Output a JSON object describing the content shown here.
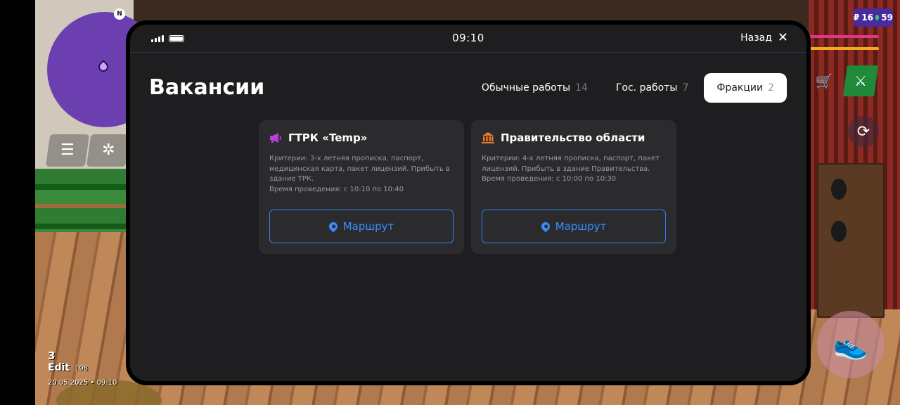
{
  "hud": {
    "compass": "N",
    "player_level": "3",
    "edit_label": "Edit",
    "player_id": "198",
    "datetime": "20.05.2025 • 09:10",
    "money": {
      "currency": "₽",
      "amount": "16",
      "extra": "59"
    },
    "menu_icon": "menu-icon",
    "settings_icon": "gear-icon",
    "cart_icon": "cart-icon",
    "weapon_icon": "weapon-icon",
    "camera_icon": "camera-rotate-icon",
    "run_icon": "sneaker-icon",
    "health_color": "#e0368a",
    "armor_color": "#f5a623"
  },
  "phone": {
    "status": {
      "time": "09:10"
    },
    "back_label": "Назад",
    "title": "Вакансии",
    "tabs": [
      {
        "label": "Обычные работы",
        "count": "14",
        "active": false
      },
      {
        "label": "Гос. работы",
        "count": "7",
        "active": false
      },
      {
        "label": "Фракции",
        "count": "2",
        "active": true
      }
    ],
    "cards": [
      {
        "icon": "megaphone-icon",
        "icon_color": "#b63fd6",
        "title": "ГТРК «Temp»",
        "criteria": "Критерии: 3-х летняя прописка, паспорт, медицинская карта, пакет лицензий. Прибыть в здание ТРК.",
        "schedule": "Время проведения: с 10:10 по 10:40",
        "button_label": "Маршрут"
      },
      {
        "icon": "government-building-icon",
        "icon_color": "#f07a2a",
        "title": "Правительство области",
        "criteria": "Критерии: 4-х летняя прописка, паспорт, пакет лицензий. Прибыть в здание Правительства.",
        "schedule": "Время проведения: с 10:00 по 10:30",
        "button_label": "Маршрут"
      }
    ]
  }
}
